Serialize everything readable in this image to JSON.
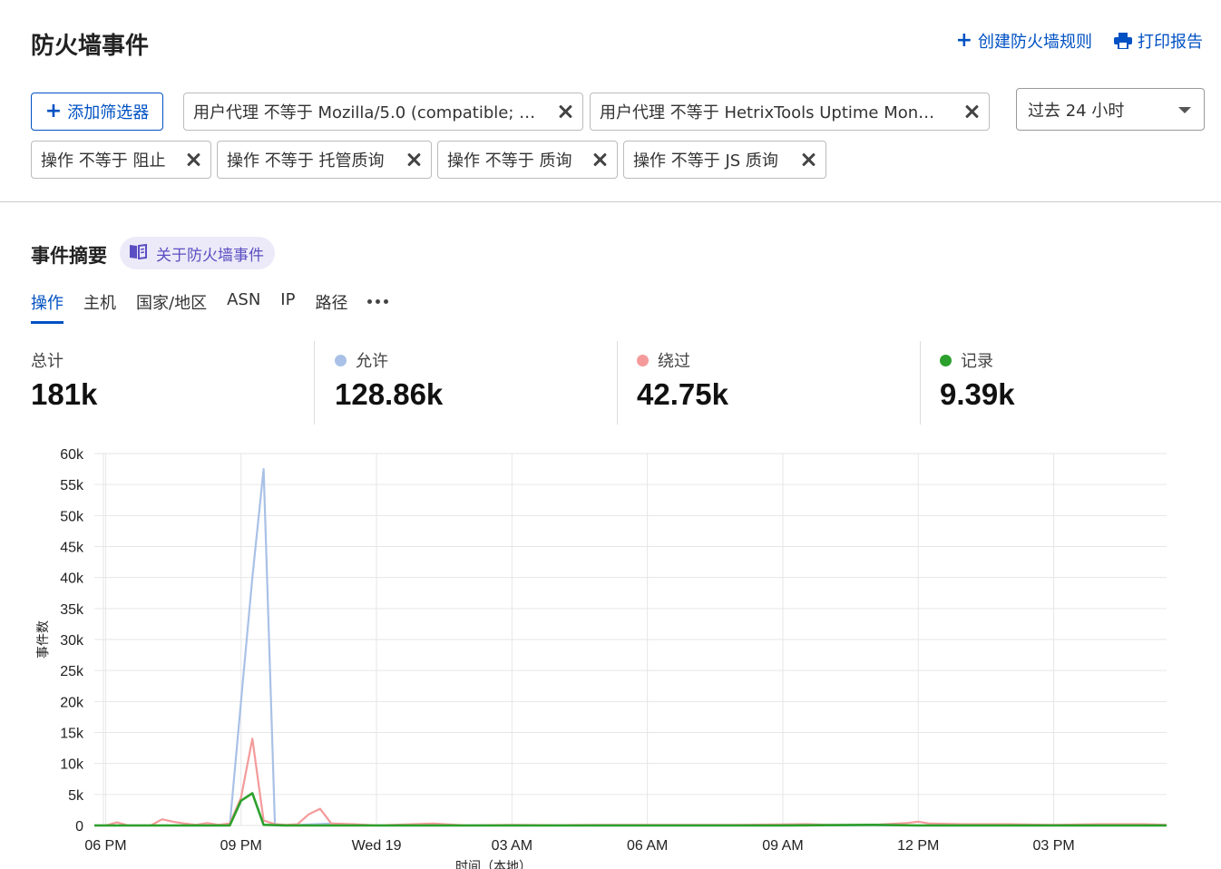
{
  "page": {
    "title": "防火墙事件",
    "create_rule": "创建防火墙规则",
    "print_report": "打印报告"
  },
  "filters": {
    "add_label": "添加筛选器",
    "chips": [
      "用户代理 不等于 Mozilla/5.0 (compatible; …",
      "用户代理 不等于 HetrixTools Uptime Mon…",
      "操作 不等于 阻止",
      "操作 不等于 托管质询",
      "操作 不等于 质询",
      "操作 不等于 JS 质询"
    ],
    "time_range": "过去 24 小时"
  },
  "summary": {
    "title": "事件摘要",
    "about_link": "关于防火墙事件",
    "tabs": [
      "操作",
      "主机",
      "国家/地区",
      "ASN",
      "IP",
      "路径"
    ],
    "active_tab": "操作"
  },
  "stats": [
    {
      "label": "总计",
      "value": "181k",
      "color": ""
    },
    {
      "label": "允许",
      "value": "128.86k",
      "color": "#a9c1e6"
    },
    {
      "label": "绕过",
      "value": "42.75k",
      "color": "#f49a9a"
    },
    {
      "label": "记录",
      "value": "9.39k",
      "color": "#2ca02c"
    }
  ],
  "chart_data": {
    "type": "line",
    "ylabel": "事件数",
    "xlabel": "时间（本地）",
    "ylim": [
      0,
      60000
    ],
    "y_ticks": [
      "0",
      "5k",
      "10k",
      "15k",
      "20k",
      "25k",
      "30k",
      "35k",
      "40k",
      "45k",
      "50k",
      "55k",
      "60k"
    ],
    "x_ticks": [
      "06 PM",
      "09 PM",
      "Wed 19",
      "03 AM",
      "06 AM",
      "09 AM",
      "12 PM",
      "03 PM"
    ],
    "x_range_hours": [
      -0.25,
      23.5
    ],
    "grid": true,
    "series": [
      {
        "name": "允许",
        "color": "#a9c1e6",
        "points": [
          [
            -0.25,
            0
          ],
          [
            0,
            0
          ],
          [
            1,
            0
          ],
          [
            2,
            0
          ],
          [
            2.75,
            0
          ],
          [
            3,
            20000
          ],
          [
            3.25,
            40000
          ],
          [
            3.5,
            57500
          ],
          [
            3.75,
            0
          ],
          [
            4,
            0
          ],
          [
            5,
            300
          ],
          [
            6,
            0
          ],
          [
            9,
            0
          ],
          [
            12,
            0
          ],
          [
            15,
            0
          ],
          [
            18,
            0
          ],
          [
            21,
            0
          ],
          [
            23.5,
            0
          ]
        ]
      },
      {
        "name": "绕过",
        "color": "#f49a9a",
        "points": [
          [
            -0.25,
            0
          ],
          [
            0,
            0
          ],
          [
            0.25,
            500
          ],
          [
            0.5,
            0
          ],
          [
            1,
            0
          ],
          [
            1.25,
            1000
          ],
          [
            1.5,
            600
          ],
          [
            1.75,
            300
          ],
          [
            2,
            100
          ],
          [
            2.25,
            400
          ],
          [
            2.5,
            100
          ],
          [
            2.75,
            300
          ],
          [
            3,
            4500
          ],
          [
            3.25,
            14000
          ],
          [
            3.5,
            800
          ],
          [
            3.75,
            200
          ],
          [
            4,
            100
          ],
          [
            4.25,
            200
          ],
          [
            4.5,
            1800
          ],
          [
            4.75,
            2700
          ],
          [
            5,
            300
          ],
          [
            5.5,
            200
          ],
          [
            6,
            0
          ],
          [
            7.25,
            300
          ],
          [
            8,
            0
          ],
          [
            9,
            100
          ],
          [
            10,
            50
          ],
          [
            11,
            100
          ],
          [
            12,
            100
          ],
          [
            14,
            100
          ],
          [
            15.5,
            200
          ],
          [
            16,
            100
          ],
          [
            17,
            100
          ],
          [
            17.75,
            400
          ],
          [
            18,
            600
          ],
          [
            18.25,
            300
          ],
          [
            19,
            200
          ],
          [
            20,
            200
          ],
          [
            21,
            100
          ],
          [
            22,
            200
          ],
          [
            23,
            200
          ],
          [
            23.5,
            100
          ]
        ]
      },
      {
        "name": "记录",
        "color": "#2ca02c",
        "points": [
          [
            -0.25,
            0
          ],
          [
            0,
            0
          ],
          [
            1,
            0
          ],
          [
            2,
            0
          ],
          [
            2.75,
            0
          ],
          [
            3,
            4000
          ],
          [
            3.25,
            5200
          ],
          [
            3.5,
            100
          ],
          [
            4,
            0
          ],
          [
            6,
            0
          ],
          [
            9,
            0
          ],
          [
            12,
            0
          ],
          [
            15,
            0
          ],
          [
            17,
            100
          ],
          [
            18,
            0
          ],
          [
            21,
            0
          ],
          [
            23.5,
            0
          ]
        ]
      }
    ]
  }
}
